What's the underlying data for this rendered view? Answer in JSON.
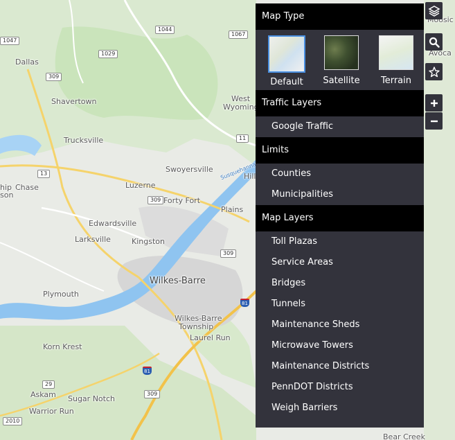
{
  "map": {
    "places": [
      {
        "name": "Dallas",
        "big": false
      },
      {
        "name": "Shavertown",
        "big": false
      },
      {
        "name": "Trucksville",
        "big": false
      },
      {
        "name": "Chase",
        "big": false
      },
      {
        "name": "Luzerne",
        "big": false
      },
      {
        "name": "Swoyersville",
        "big": false
      },
      {
        "name": "Forty Fort",
        "big": false
      },
      {
        "name": "Edwardsville",
        "big": false
      },
      {
        "name": "Larksville",
        "big": false
      },
      {
        "name": "Kingston",
        "big": false
      },
      {
        "name": "Plains",
        "big": false
      },
      {
        "name": "Wilkes-Barre",
        "big": true
      },
      {
        "name": "Plymouth",
        "big": false
      },
      {
        "name": "Wilkes-Barre",
        "big": false
      },
      {
        "name": "Township",
        "big": false
      },
      {
        "name": "Laurel Run",
        "big": false
      },
      {
        "name": "Korn Krest",
        "big": false
      },
      {
        "name": "Askam",
        "big": false
      },
      {
        "name": "Sugar Notch",
        "big": false
      },
      {
        "name": "Warrior Run",
        "big": false
      },
      {
        "name": "West",
        "big": false
      },
      {
        "name": "Wyoming",
        "big": false
      },
      {
        "name": "Hill",
        "big": false
      },
      {
        "name": "Avoca",
        "big": false
      },
      {
        "name": "Moosic",
        "big": false
      },
      {
        "name": "Bear Creek",
        "big": false
      },
      {
        "name": "hip",
        "big": false
      },
      {
        "name": "son",
        "big": false
      },
      {
        "name": "Susquehanna River",
        "big": false
      }
    ],
    "shields": [
      "1047",
      "1044",
      "1067",
      "1029",
      "309",
      "13",
      "309",
      "309",
      "11",
      "309",
      "29",
      "2010"
    ],
    "interstate_shields": [
      "81",
      "81"
    ]
  },
  "panel": {
    "map_type": {
      "title": "Map Type",
      "options": [
        {
          "label": "Default",
          "active": true
        },
        {
          "label": "Satellite",
          "active": false
        },
        {
          "label": "Terrain",
          "active": false
        }
      ]
    },
    "traffic": {
      "title": "Traffic Layers",
      "items": [
        "Google Traffic"
      ]
    },
    "limits": {
      "title": "Limits",
      "items": [
        "Counties",
        "Municipalities"
      ]
    },
    "layers": {
      "title": "Map Layers",
      "items": [
        "Toll Plazas",
        "Service Areas",
        "Bridges",
        "Tunnels",
        "Maintenance Sheds",
        "Microwave Towers",
        "Maintenance Districts",
        "PennDOT Districts",
        "Weigh Barriers"
      ]
    }
  },
  "controls": {
    "icons": [
      "layers-icon",
      "search-icon",
      "star-icon",
      "zoom-in-icon",
      "zoom-out-icon"
    ]
  }
}
